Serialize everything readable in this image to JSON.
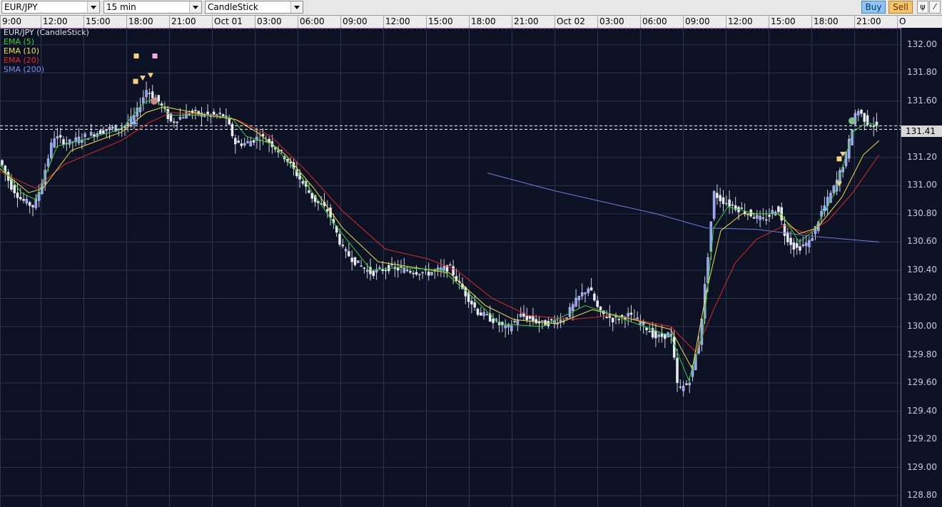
{
  "toolbar": {
    "symbol": "EUR/JPY",
    "interval": "15 min",
    "chart_style": "CandleStick",
    "buy_label": "Buy",
    "sell_label": "Sell"
  },
  "x_ticks": [
    "9:00",
    "12:00",
    "15:00",
    "18:00",
    "21:00",
    "Oct 01",
    "03:00",
    "06:00",
    "09:00",
    "12:00",
    "15:00",
    "18:00",
    "21:00",
    "Oct 02",
    "03:00",
    "06:00",
    "09:00",
    "12:00",
    "15:00",
    "18:00",
    "21:00",
    "O"
  ],
  "legend": [
    {
      "label": "EUR/JPY (CandleStick)",
      "color": "#e0e0e0"
    },
    {
      "label": "EMA (5)",
      "color": "#35d135"
    },
    {
      "label": "EMA (10)",
      "color": "#f0e040"
    },
    {
      "label": "EMA (20)",
      "color": "#e02828"
    },
    {
      "label": "SMA (200)",
      "color": "#7d8ee8"
    }
  ],
  "y_ticks": [
    "132.00",
    "131.80",
    "131.60",
    "131.41",
    "131.20",
    "131.00",
    "130.80",
    "130.60",
    "130.40",
    "130.20",
    "130.00",
    "129.80",
    "129.60",
    "129.40",
    "129.20",
    "129.00",
    "128.80"
  ],
  "current_price": "131.41",
  "chart_data": {
    "type": "candlestick",
    "symbol": "EUR/JPY",
    "interval": "15 min",
    "ylim": [
      128.72,
      132.12
    ],
    "grid": true,
    "y_axis_ticks": [
      132.0,
      131.8,
      131.6,
      131.2,
      131.0,
      130.8,
      130.6,
      130.4,
      130.2,
      130.0,
      129.8,
      129.6,
      129.4,
      129.2,
      129.0,
      128.8
    ],
    "current_price": 131.41,
    "price_path": [
      [
        0,
        131.18
      ],
      [
        15,
        131.0
      ],
      [
        30,
        130.9
      ],
      [
        48,
        130.85
      ],
      [
        60,
        131.05
      ],
      [
        75,
        131.35
      ],
      [
        95,
        131.3
      ],
      [
        120,
        131.35
      ],
      [
        150,
        131.4
      ],
      [
        175,
        131.42
      ],
      [
        190,
        131.5
      ],
      [
        205,
        131.68
      ],
      [
        222,
        131.6
      ],
      [
        240,
        131.45
      ],
      [
        265,
        131.52
      ],
      [
        290,
        131.5
      ],
      [
        315,
        131.5
      ],
      [
        330,
        131.3
      ],
      [
        345,
        131.3
      ],
      [
        365,
        131.35
      ],
      [
        380,
        131.3
      ],
      [
        400,
        131.2
      ],
      [
        420,
        131.05
      ],
      [
        440,
        130.9
      ],
      [
        460,
        130.82
      ],
      [
        480,
        130.55
      ],
      [
        500,
        130.45
      ],
      [
        520,
        130.38
      ],
      [
        545,
        130.42
      ],
      [
        570,
        130.4
      ],
      [
        600,
        130.38
      ],
      [
        630,
        130.42
      ],
      [
        650,
        130.25
      ],
      [
        670,
        130.1
      ],
      [
        690,
        130.05
      ],
      [
        710,
        129.98
      ],
      [
        730,
        130.08
      ],
      [
        760,
        130.02
      ],
      [
        790,
        130.05
      ],
      [
        810,
        130.2
      ],
      [
        825,
        130.28
      ],
      [
        840,
        130.1
      ],
      [
        860,
        130.05
      ],
      [
        880,
        130.08
      ],
      [
        900,
        130.02
      ],
      [
        920,
        129.92
      ],
      [
        940,
        129.95
      ],
      [
        950,
        129.55
      ],
      [
        965,
        129.6
      ],
      [
        980,
        129.9
      ],
      [
        990,
        130.4
      ],
      [
        1000,
        130.95
      ],
      [
        1010,
        130.9
      ],
      [
        1030,
        130.85
      ],
      [
        1050,
        130.8
      ],
      [
        1070,
        130.75
      ],
      [
        1090,
        130.85
      ],
      [
        1100,
        130.65
      ],
      [
        1115,
        130.55
      ],
      [
        1135,
        130.6
      ],
      [
        1150,
        130.8
      ],
      [
        1170,
        131.0
      ],
      [
        1185,
        131.2
      ],
      [
        1200,
        131.55
      ],
      [
        1215,
        131.45
      ],
      [
        1232,
        131.41
      ]
    ],
    "ema5": [
      [
        0,
        131.15
      ],
      [
        30,
        130.95
      ],
      [
        50,
        130.9
      ],
      [
        80,
        131.28
      ],
      [
        120,
        131.33
      ],
      [
        170,
        131.4
      ],
      [
        200,
        131.58
      ],
      [
        215,
        131.62
      ],
      [
        240,
        131.5
      ],
      [
        290,
        131.5
      ],
      [
        325,
        131.48
      ],
      [
        345,
        131.35
      ],
      [
        380,
        131.3
      ],
      [
        420,
        131.08
      ],
      [
        470,
        130.72
      ],
      [
        520,
        130.4
      ],
      [
        560,
        130.42
      ],
      [
        620,
        130.4
      ],
      [
        660,
        130.22
      ],
      [
        700,
        130.02
      ],
      [
        760,
        130.0
      ],
      [
        820,
        130.15
      ],
      [
        860,
        130.08
      ],
      [
        940,
        129.93
      ],
      [
        965,
        129.62
      ],
      [
        985,
        129.95
      ],
      [
        1000,
        130.7
      ],
      [
        1020,
        130.85
      ],
      [
        1060,
        130.8
      ],
      [
        1095,
        130.8
      ],
      [
        1120,
        130.6
      ],
      [
        1140,
        130.68
      ],
      [
        1170,
        130.95
      ],
      [
        1195,
        131.38
      ],
      [
        1215,
        131.45
      ],
      [
        1232,
        131.42
      ]
    ],
    "ema10": [
      [
        0,
        131.12
      ],
      [
        40,
        130.95
      ],
      [
        60,
        130.98
      ],
      [
        100,
        131.25
      ],
      [
        170,
        131.38
      ],
      [
        205,
        131.52
      ],
      [
        230,
        131.56
      ],
      [
        290,
        131.5
      ],
      [
        330,
        131.47
      ],
      [
        360,
        131.38
      ],
      [
        400,
        131.22
      ],
      [
        440,
        130.98
      ],
      [
        480,
        130.7
      ],
      [
        530,
        130.46
      ],
      [
        580,
        130.42
      ],
      [
        630,
        130.38
      ],
      [
        680,
        130.15
      ],
      [
        720,
        130.05
      ],
      [
        780,
        130.02
      ],
      [
        830,
        130.12
      ],
      [
        880,
        130.06
      ],
      [
        940,
        129.98
      ],
      [
        970,
        129.7
      ],
      [
        990,
        130.25
      ],
      [
        1010,
        130.68
      ],
      [
        1040,
        130.8
      ],
      [
        1090,
        130.8
      ],
      [
        1120,
        130.66
      ],
      [
        1145,
        130.7
      ],
      [
        1180,
        130.92
      ],
      [
        1210,
        131.22
      ],
      [
        1232,
        131.32
      ]
    ],
    "ema20": [
      [
        0,
        131.1
      ],
      [
        50,
        130.98
      ],
      [
        90,
        131.15
      ],
      [
        170,
        131.32
      ],
      [
        210,
        131.45
      ],
      [
        240,
        131.52
      ],
      [
        300,
        131.5
      ],
      [
        335,
        131.46
      ],
      [
        380,
        131.35
      ],
      [
        430,
        131.1
      ],
      [
        480,
        130.82
      ],
      [
        540,
        130.55
      ],
      [
        600,
        130.48
      ],
      [
        640,
        130.4
      ],
      [
        690,
        130.2
      ],
      [
        740,
        130.08
      ],
      [
        800,
        130.05
      ],
      [
        860,
        130.08
      ],
      [
        940,
        130.0
      ],
      [
        975,
        129.82
      ],
      [
        1000,
        130.12
      ],
      [
        1030,
        130.45
      ],
      [
        1060,
        130.62
      ],
      [
        1100,
        130.72
      ],
      [
        1130,
        130.66
      ],
      [
        1160,
        130.75
      ],
      [
        1195,
        130.95
      ],
      [
        1232,
        131.22
      ]
    ],
    "sma200": [
      [
        683,
        131.09
      ],
      [
        720,
        131.04
      ],
      [
        780,
        130.96
      ],
      [
        850,
        130.88
      ],
      [
        920,
        130.8
      ],
      [
        990,
        130.7
      ],
      [
        1060,
        130.69
      ],
      [
        1140,
        130.64
      ],
      [
        1232,
        130.6
      ]
    ],
    "markers": [
      {
        "type": "square",
        "x": 191,
        "y": 131.92,
        "color": "#f2d27a"
      },
      {
        "type": "square",
        "x": 217,
        "y": 131.92,
        "color": "#f5a8e6"
      },
      {
        "type": "square",
        "x": 190,
        "y": 131.74,
        "color": "#f2d27a"
      },
      {
        "type": "triangle-down",
        "x": 200,
        "y": 131.76,
        "color": "#f2d27a"
      },
      {
        "type": "triangle-down",
        "x": 211,
        "y": 131.78,
        "color": "#f2d27a"
      },
      {
        "type": "triangle-up",
        "x": 188,
        "y": 131.45,
        "color": "#7fc4ff"
      },
      {
        "type": "circle",
        "x": 216,
        "y": 131.6,
        "color": "#c98a8a"
      },
      {
        "type": "square",
        "x": 1176,
        "y": 131.19,
        "color": "#f2d27a"
      },
      {
        "type": "triangle-down",
        "x": 1181,
        "y": 131.22,
        "color": "#f2d27a"
      },
      {
        "type": "triangle-down",
        "x": 1176,
        "y": 131.01,
        "color": "#f2d27a"
      },
      {
        "type": "triangle-up",
        "x": 1156,
        "y": 130.84,
        "color": "#7fc4ff"
      },
      {
        "type": "circle",
        "x": 1194,
        "y": 131.46,
        "color": "#7fbf7f"
      }
    ]
  }
}
